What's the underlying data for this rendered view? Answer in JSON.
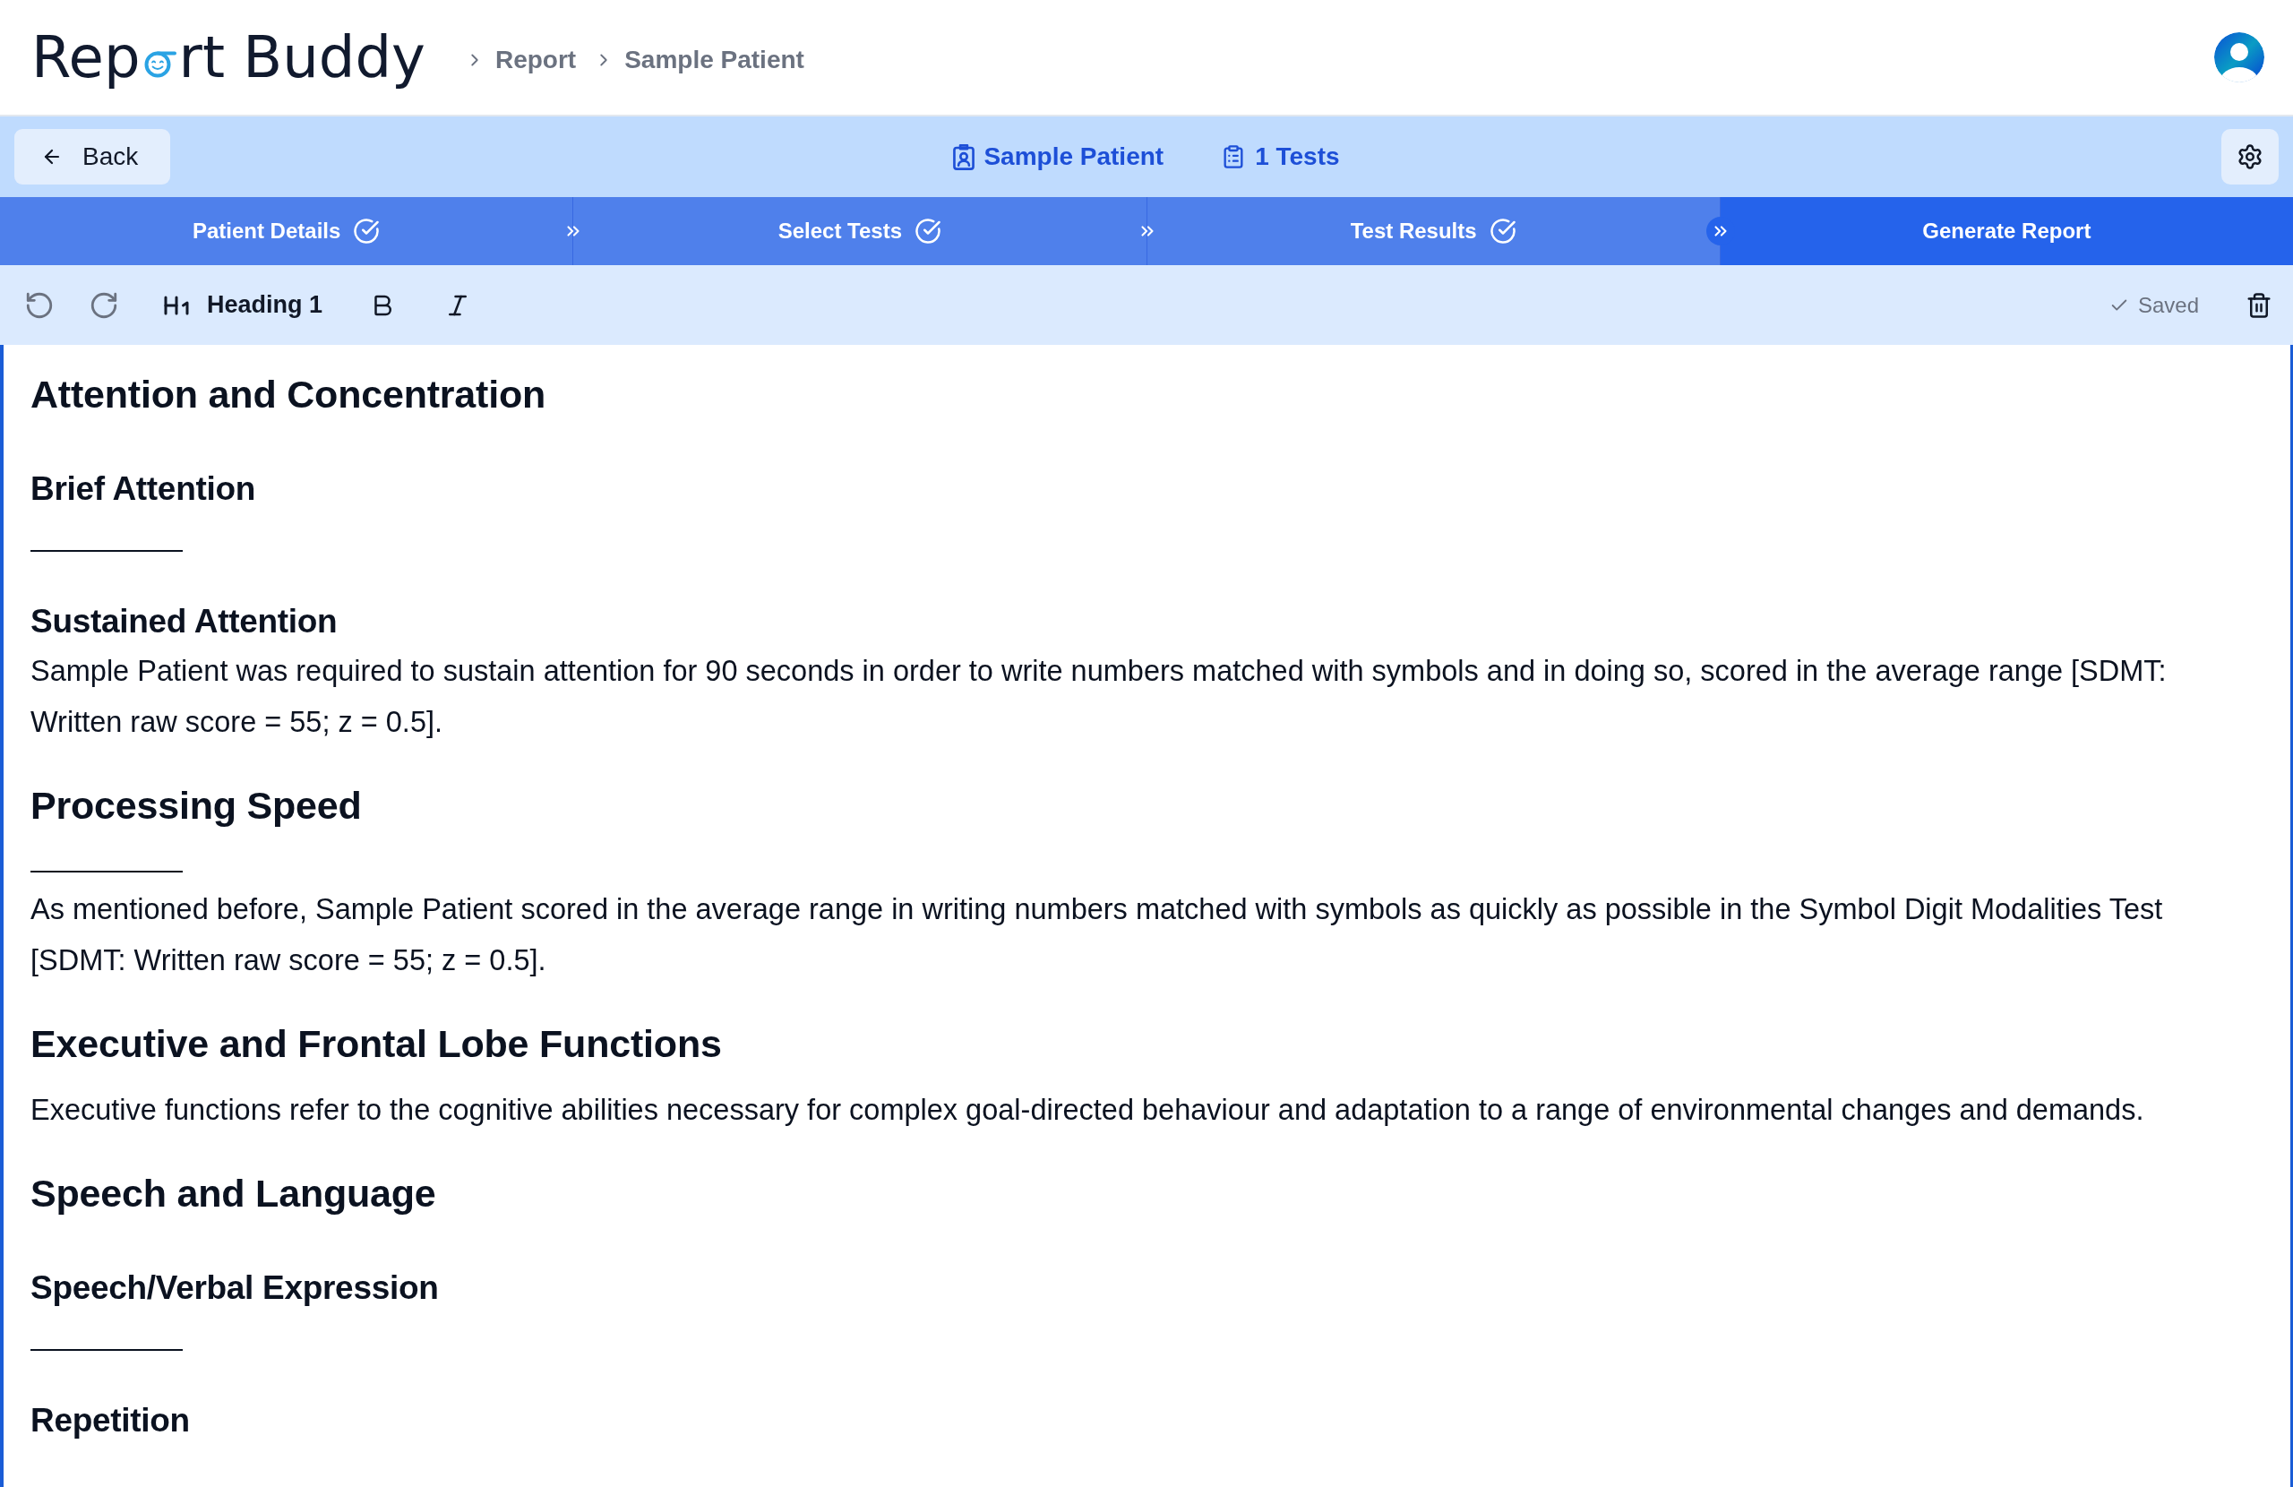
{
  "header": {
    "logo": {
      "start": "Rep",
      "end": "rt Buddy"
    },
    "breadcrumb": [
      "Report",
      "Sample Patient"
    ]
  },
  "top_bar": {
    "back_button": "Back",
    "patient": "Sample Patient",
    "tests": "1 Tests"
  },
  "steps": [
    {
      "label": "Patient Details",
      "completed": true,
      "selected": false
    },
    {
      "label": "Select Tests",
      "completed": true,
      "selected": false
    },
    {
      "label": "Test Results",
      "completed": true,
      "selected": false
    },
    {
      "label": "Generate Report",
      "completed": false,
      "selected": true
    }
  ],
  "editor_toolbar": {
    "history": [
      {
        "kind": "undo",
        "disabled": true
      },
      {
        "kind": "redo",
        "disabled": true
      }
    ],
    "block_type": "Heading 1",
    "save_status": "Saved"
  },
  "document": [
    {
      "kind": "heading1",
      "text": "Attention and Concentration"
    },
    {
      "kind": "heading2",
      "text": "Brief Attention"
    },
    {
      "kind": "blank"
    },
    {
      "kind": "heading2",
      "text": "Sustained Attention"
    },
    {
      "kind": "paragraph",
      "text": "Sample Patient was required to sustain attention for 90 seconds in order to write numbers matched with symbols and in doing so, scored in the average range [SDMT: Written raw score = 55; z = 0.5]."
    },
    {
      "kind": "heading1",
      "text": "Processing Speed"
    },
    {
      "kind": "blank"
    },
    {
      "kind": "paragraph",
      "text": "As mentioned before, Sample Patient scored in the average range in writing numbers matched with symbols as quickly as possible in the Symbol Digit Modalities Test [SDMT: Written raw score = 55; z = 0.5]."
    },
    {
      "kind": "heading1",
      "text": "Executive and Frontal Lobe Functions"
    },
    {
      "kind": "paragraph",
      "text": "Executive functions refer to the cognitive abilities necessary for complex goal-directed behaviour and adaptation to a range of environmental changes and demands."
    },
    {
      "kind": "heading1",
      "text": "Speech and Language"
    },
    {
      "kind": "heading2",
      "text": "Speech/Verbal Expression"
    },
    {
      "kind": "blank"
    },
    {
      "kind": "heading2",
      "text": "Repetition"
    }
  ]
}
